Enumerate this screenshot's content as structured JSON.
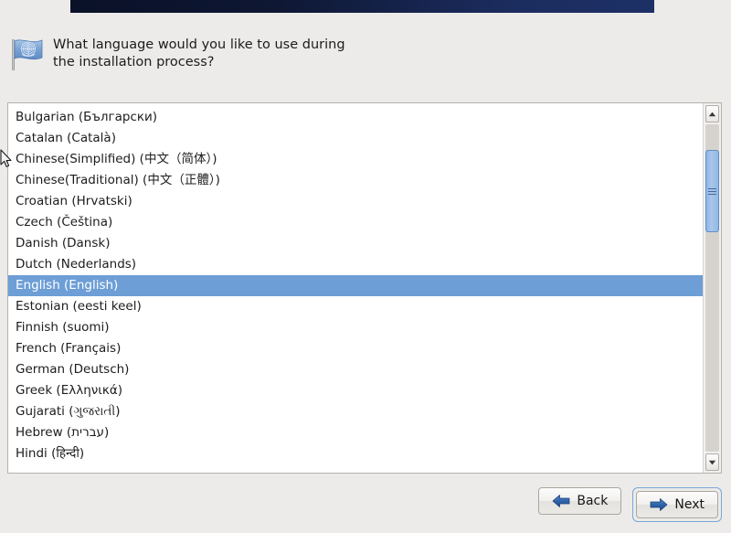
{
  "window": {
    "background_color": "#ecebe9",
    "banner_color_left": "#0a1128",
    "banner_color_right": "#1d3066"
  },
  "header": {
    "icon": "un-flag-icon",
    "question": "What language would you like to use during the installation process?"
  },
  "language_list": {
    "selected": "English (English)",
    "selection_color": "#6d9ed6",
    "items": [
      "Bulgarian (Български)",
      "Catalan (Català)",
      "Chinese(Simplified) (中文（简体）)",
      "Chinese(Traditional) (中文（正體）)",
      "Croatian (Hrvatski)",
      "Czech (Čeština)",
      "Danish (Dansk)",
      "Dutch (Nederlands)",
      "English (English)",
      "Estonian (eesti keel)",
      "Finnish (suomi)",
      "French (Français)",
      "German (Deutsch)",
      "Greek (Ελληνικά)",
      "Gujarati (ગુજરાતી)",
      "Hebrew (עברית)",
      "Hindi (हिन्दी)"
    ]
  },
  "scrollbar": {
    "up_arrow": "chevron-up-icon",
    "down_arrow": "chevron-down-icon",
    "thumb_color": "#93b8e4"
  },
  "buttons": {
    "back": {
      "label": "Back",
      "icon": "arrow-left-icon",
      "icon_color": "#2a5fa8",
      "focused": false
    },
    "next": {
      "label": "Next",
      "icon": "arrow-right-icon",
      "icon_color": "#2a5fa8",
      "focused": true
    }
  }
}
